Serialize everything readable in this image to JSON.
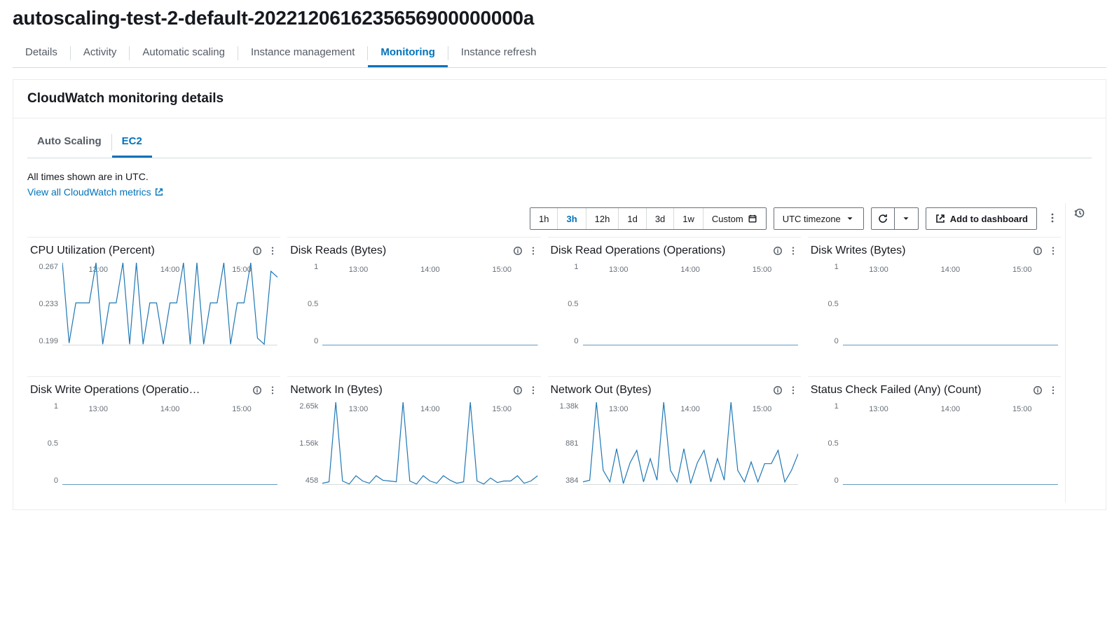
{
  "page_title": "autoscaling-test-2-default-2022120616235656900000000a",
  "tabs": [
    "Details",
    "Activity",
    "Automatic scaling",
    "Instance management",
    "Monitoring",
    "Instance refresh"
  ],
  "active_tab": 4,
  "panel_title": "CloudWatch monitoring details",
  "subtabs": [
    "Auto Scaling",
    "EC2"
  ],
  "active_subtab": 1,
  "tz_note": "All times shown are in UTC.",
  "link_text": "View all CloudWatch metrics",
  "time_ranges": [
    "1h",
    "3h",
    "12h",
    "1d",
    "3d",
    "1w"
  ],
  "active_range": 1,
  "custom_label": "Custom",
  "tz_label": "UTC timezone",
  "add_dashboard": "Add to dashboard",
  "chart_data": [
    {
      "title": "CPU Utilization (Percent)",
      "type": "line",
      "y_ticks": [
        "0.267",
        "0.233",
        "0.199"
      ],
      "x_ticks": [
        "13:00",
        "14:00",
        "15:00"
      ],
      "ylim": [
        0.199,
        0.267
      ],
      "values": [
        0.267,
        0.201,
        0.234,
        0.234,
        0.234,
        0.267,
        0.2,
        0.234,
        0.234,
        0.267,
        0.2,
        0.267,
        0.2,
        0.234,
        0.234,
        0.2,
        0.234,
        0.234,
        0.267,
        0.2,
        0.267,
        0.2,
        0.234,
        0.234,
        0.267,
        0.2,
        0.234,
        0.234,
        0.267,
        0.205,
        0.2,
        0.26,
        0.255
      ]
    },
    {
      "title": "Disk Reads (Bytes)",
      "type": "line",
      "y_ticks": [
        "1",
        "0.5",
        "0"
      ],
      "x_ticks": [
        "13:00",
        "14:00",
        "15:00"
      ],
      "ylim": [
        0,
        1
      ],
      "values": [
        0,
        0,
        0,
        0,
        0,
        0,
        0,
        0,
        0,
        0,
        0,
        0,
        0,
        0,
        0,
        0,
        0,
        0,
        0,
        0,
        0,
        0,
        0,
        0,
        0,
        0,
        0,
        0,
        0,
        0,
        0,
        0,
        0
      ]
    },
    {
      "title": "Disk Read Operations (Operations)",
      "type": "line",
      "y_ticks": [
        "1",
        "0.5",
        "0"
      ],
      "x_ticks": [
        "13:00",
        "14:00",
        "15:00"
      ],
      "ylim": [
        0,
        1
      ],
      "values": [
        0,
        0,
        0,
        0,
        0,
        0,
        0,
        0,
        0,
        0,
        0,
        0,
        0,
        0,
        0,
        0,
        0,
        0,
        0,
        0,
        0,
        0,
        0,
        0,
        0,
        0,
        0,
        0,
        0,
        0,
        0,
        0,
        0
      ]
    },
    {
      "title": "Disk Writes (Bytes)",
      "type": "line",
      "y_ticks": [
        "1",
        "0.5",
        "0"
      ],
      "x_ticks": [
        "13:00",
        "14:00",
        "15:00"
      ],
      "ylim": [
        0,
        1
      ],
      "values": [
        0,
        0,
        0,
        0,
        0,
        0,
        0,
        0,
        0,
        0,
        0,
        0,
        0,
        0,
        0,
        0,
        0,
        0,
        0,
        0,
        0,
        0,
        0,
        0,
        0,
        0,
        0,
        0,
        0,
        0,
        0,
        0,
        0
      ]
    },
    {
      "title": "Disk Write Operations (Operatio…",
      "type": "line",
      "y_ticks": [
        "1",
        "0.5",
        "0"
      ],
      "x_ticks": [
        "13:00",
        "14:00",
        "15:00"
      ],
      "ylim": [
        0,
        1
      ],
      "values": [
        0,
        0,
        0,
        0,
        0,
        0,
        0,
        0,
        0,
        0,
        0,
        0,
        0,
        0,
        0,
        0,
        0,
        0,
        0,
        0,
        0,
        0,
        0,
        0,
        0,
        0,
        0,
        0,
        0,
        0,
        0,
        0,
        0
      ]
    },
    {
      "title": "Network In (Bytes)",
      "type": "line",
      "y_ticks": [
        "2.65k",
        "1.56k",
        "458"
      ],
      "x_ticks": [
        "13:00",
        "14:00",
        "15:00"
      ],
      "ylim": [
        458,
        2650
      ],
      "values": [
        500,
        540,
        2650,
        560,
        480,
        700,
        560,
        500,
        700,
        580,
        560,
        540,
        2650,
        560,
        480,
        700,
        560,
        500,
        700,
        580,
        500,
        540,
        2650,
        560,
        480,
        640,
        520,
        560,
        560,
        700,
        500,
        560,
        700
      ]
    },
    {
      "title": "Network Out (Bytes)",
      "type": "line",
      "y_ticks": [
        "1.38k",
        "881",
        "384"
      ],
      "x_ticks": [
        "13:00",
        "14:00",
        "15:00"
      ],
      "ylim": [
        384,
        1380
      ],
      "values": [
        420,
        440,
        1380,
        560,
        420,
        820,
        400,
        650,
        800,
        420,
        700,
        440,
        1380,
        560,
        420,
        820,
        400,
        650,
        800,
        420,
        700,
        440,
        1380,
        560,
        420,
        660,
        420,
        640,
        640,
        800,
        420,
        560,
        760
      ]
    },
    {
      "title": "Status Check Failed (Any) (Count)",
      "type": "line",
      "y_ticks": [
        "1",
        "0.5",
        "0"
      ],
      "x_ticks": [
        "13:00",
        "14:00",
        "15:00"
      ],
      "ylim": [
        0,
        1
      ],
      "values": [
        0,
        0,
        0,
        0,
        0,
        0,
        0,
        0,
        0,
        0,
        0,
        0,
        0,
        0,
        0,
        0,
        0,
        0,
        0,
        0,
        0,
        0,
        0,
        0,
        0,
        0,
        0,
        0,
        0,
        0,
        0,
        0,
        0
      ]
    }
  ]
}
